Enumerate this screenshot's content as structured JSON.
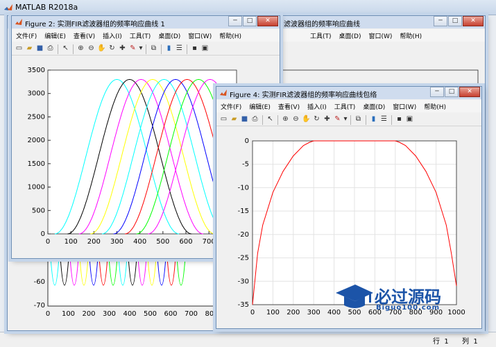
{
  "main_window": {
    "title": "MATLAB R2018a",
    "status": {
      "row_label": "行",
      "row_value": "1",
      "col_label": "列",
      "col_value": "1"
    }
  },
  "menus": [
    "文件(F)",
    "编辑(E)",
    "查看(V)",
    "插入(I)",
    "工具(T)",
    "桌面(D)",
    "窗口(W)",
    "帮助(H)"
  ],
  "toolbar_icons": [
    "new-figure-icon",
    "open-icon",
    "save-icon",
    "print-icon",
    "pointer-icon",
    "zoom-in-icon",
    "zoom-out-icon",
    "pan-icon",
    "rotate-icon",
    "data-cursor-icon",
    "brush-icon",
    "link-icon",
    "colorbar-icon",
    "legend-icon",
    "hide-plot-tools-icon",
    "show-plot-tools-icon"
  ],
  "figure_back": {
    "title": "滤波器组的频率响应曲线",
    "bottom_ticks_y": [
      "-60",
      "-70"
    ],
    "bottom_ticks_x": [
      "0",
      "100",
      "200",
      "300",
      "400",
      "500",
      "600",
      "700",
      "800"
    ]
  },
  "figure2": {
    "title": "Figure 2: 实测FIR滤波器组的频率响应曲线 1",
    "chart_data": {
      "type": "line",
      "title": "",
      "xlabel": "",
      "ylabel": "",
      "xlim": [
        0,
        820
      ],
      "ylim": [
        0,
        3500
      ],
      "xticks": [
        0,
        100,
        200,
        300,
        400,
        500,
        600,
        700,
        800
      ],
      "yticks": [
        0,
        500,
        1000,
        1500,
        2000,
        2500,
        3000,
        3500
      ],
      "grid": false,
      "series_peaks": [
        300,
        355,
        405,
        455,
        505,
        555,
        605,
        655,
        705
      ],
      "series_peak_value": 3300,
      "series_width": 270,
      "series_colors": [
        "#00ffff",
        "#000000",
        "#ff00ff",
        "#ffff00",
        "#00ffff",
        "#0000ff",
        "#ff0000",
        "#00ff00",
        "#ff00ff"
      ]
    }
  },
  "figure4": {
    "title": "Figure 4: 实测FIR滤波器组的频率响应曲线包络",
    "chart_data": {
      "type": "line",
      "title": "",
      "xlabel": "",
      "ylabel": "",
      "xlim": [
        0,
        1000
      ],
      "ylim": [
        -35,
        0
      ],
      "xticks": [
        0,
        100,
        200,
        300,
        400,
        500,
        600,
        700,
        800,
        900,
        1000
      ],
      "yticks": [
        0,
        -5,
        -10,
        -15,
        -20,
        -25,
        -30,
        -35
      ],
      "grid": true,
      "series": [
        {
          "color": "#ff0000",
          "x": [
            0,
            25,
            50,
            100,
            150,
            200,
            250,
            280,
            300,
            350,
            400,
            450,
            500,
            550,
            600,
            650,
            700,
            720,
            750,
            800,
            850,
            900,
            950,
            975,
            1000
          ],
          "y": [
            -35,
            -24,
            -18,
            -11,
            -6.5,
            -3.2,
            -1,
            -0.3,
            0,
            0,
            0,
            0,
            0,
            0,
            0,
            0,
            0,
            -0.3,
            -1,
            -3.2,
            -6.5,
            -11,
            -18,
            -24,
            -31
          ]
        }
      ]
    }
  },
  "watermark": {
    "text": "必过源码",
    "url": "Biguo100.com"
  }
}
